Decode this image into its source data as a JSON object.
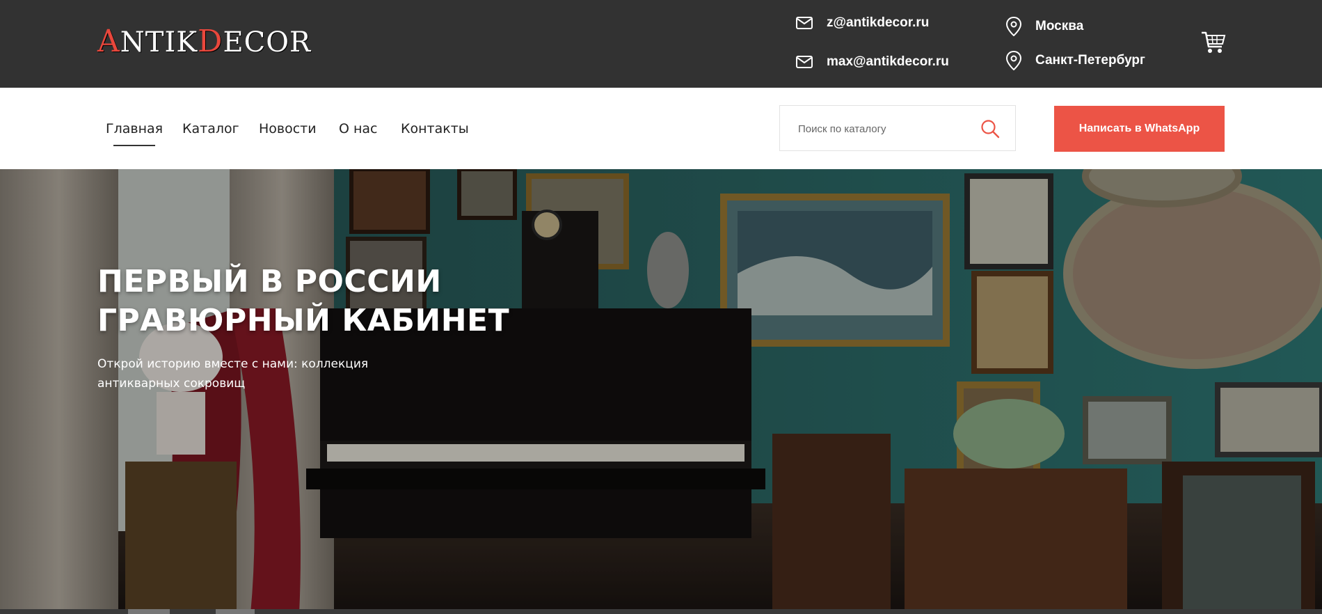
{
  "header": {
    "logo": {
      "first": "A",
      "part1": "NTIK",
      "accent2": "D",
      "part2": "ECOR"
    },
    "emails": [
      "z@antikdecor.ru",
      "max@antikdecor.ru"
    ],
    "cities": [
      "Москва",
      "Санкт-Петербург"
    ],
    "icons": {
      "email": "mail-icon",
      "location": "map-pin-icon",
      "cart": "cart-icon"
    }
  },
  "nav": {
    "items": [
      {
        "label": "Главная",
        "active": true
      },
      {
        "label": "Каталог",
        "active": false
      },
      {
        "label": "Новости",
        "active": false
      },
      {
        "label": "О нас",
        "active": false
      },
      {
        "label": "Контакты",
        "active": false
      }
    ]
  },
  "search": {
    "placeholder": "Поиск по каталогу",
    "icon": "search-icon"
  },
  "cta": {
    "label": "Написать в WhatsApp"
  },
  "hero": {
    "title_line1": "ПЕРВЫЙ В РОССИИ",
    "title_line2": "ГРАВЮРНЫЙ КАБИНЕТ",
    "subtitle": "Открой историю вместе с нами: коллекция антикварных сокровищ"
  },
  "colors": {
    "topbar": "#323232",
    "accent": "#ec5446",
    "logo_accent": "#e9473c",
    "wall": "#2b6e6b"
  }
}
